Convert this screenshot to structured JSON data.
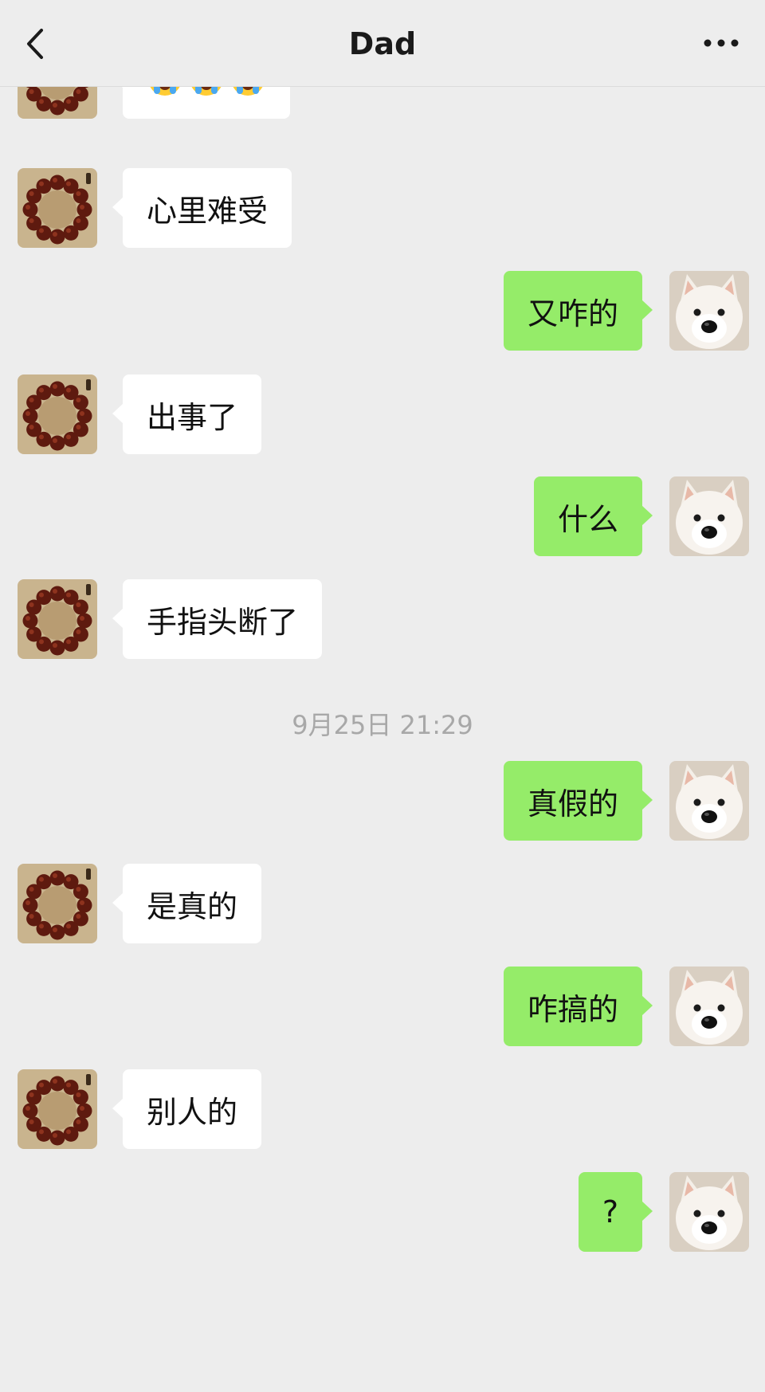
{
  "header": {
    "title": "Dad",
    "back_icon": "chevron-left-icon",
    "more_icon": "more-dots-icon"
  },
  "colors": {
    "background": "#ededed",
    "incoming_bubble": "#ffffff",
    "outgoing_bubble": "#95ec69",
    "timestamp_text": "#a8a8a8"
  },
  "messages": [
    {
      "side": "left",
      "type": "emoji",
      "emoji": [
        "loudly-crying-face-icon",
        "loudly-crying-face-icon",
        "loudly-crying-face-icon"
      ]
    },
    {
      "side": "left",
      "type": "text",
      "text": "心里难受"
    },
    {
      "side": "right",
      "type": "text",
      "text": "又咋的"
    },
    {
      "side": "left",
      "type": "text",
      "text": "出事了"
    },
    {
      "side": "right",
      "type": "text",
      "text": "什么"
    },
    {
      "side": "left",
      "type": "text",
      "text": "手指头断了"
    },
    {
      "type": "timestamp",
      "text": "9月25日 21:29"
    },
    {
      "side": "right",
      "type": "text",
      "text": "真假的"
    },
    {
      "side": "left",
      "type": "text",
      "text": "是真的"
    },
    {
      "side": "right",
      "type": "text",
      "text": "咋搞的"
    },
    {
      "side": "left",
      "type": "text",
      "text": "别人的"
    },
    {
      "side": "right",
      "type": "text",
      "text": "?"
    }
  ],
  "avatars": {
    "left": "bead-bracelet-avatar",
    "right": "west-highland-terrier-avatar"
  }
}
